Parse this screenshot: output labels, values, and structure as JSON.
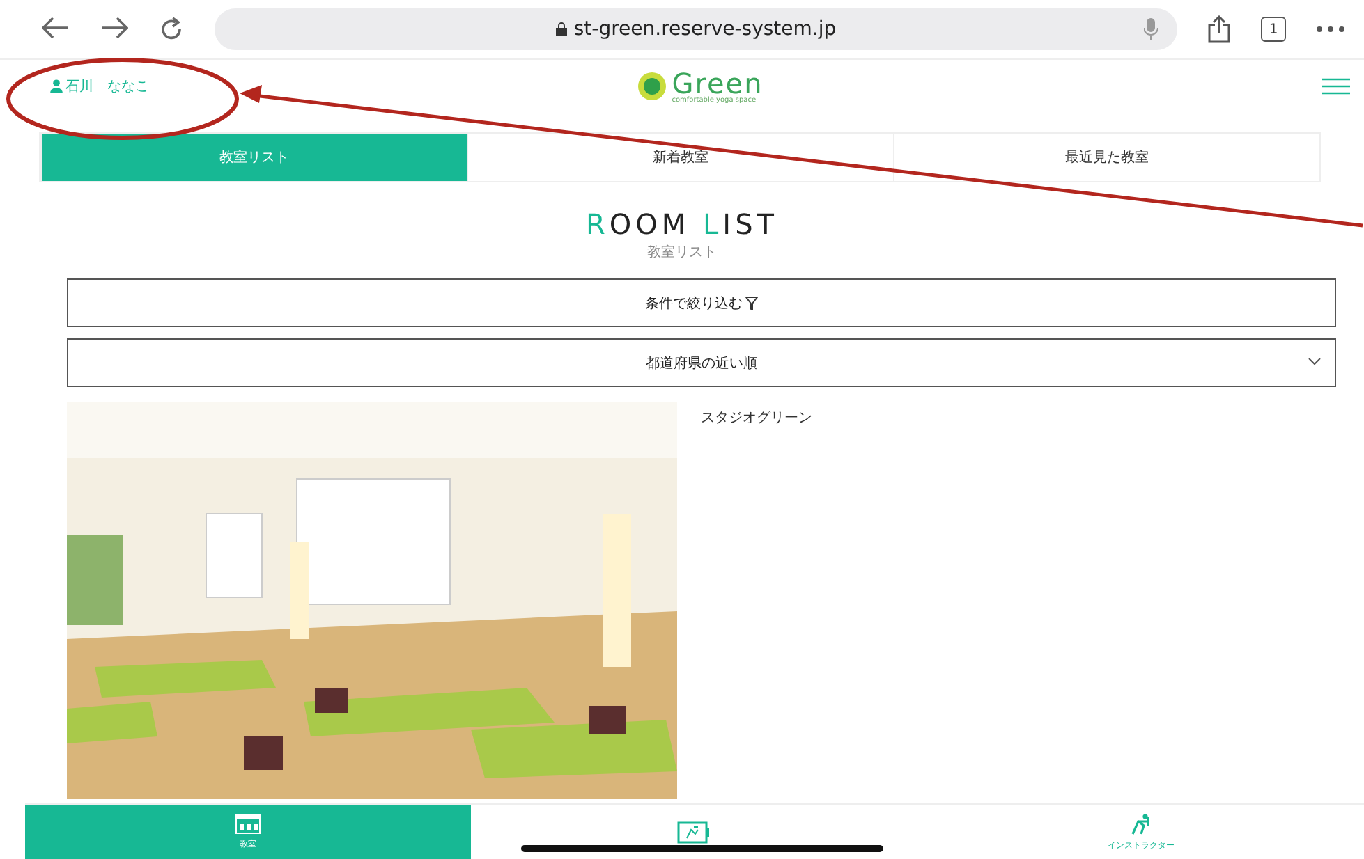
{
  "browser": {
    "url": "st-green.reserve-system.jp",
    "tab_count": "1"
  },
  "header": {
    "user_name": "石川　ななこ",
    "logo_name": "Green",
    "logo_tagline": "comfortable yoga space"
  },
  "tabs": [
    {
      "label": "教室リスト",
      "selected": true
    },
    {
      "label": "新着教室",
      "selected": false
    },
    {
      "label": "最近見た教室",
      "selected": false
    }
  ],
  "heading": {
    "title_parts": [
      {
        "text": "R",
        "accent": true
      },
      {
        "text": "OOM ",
        "accent": false
      },
      {
        "text": "L",
        "accent": true
      },
      {
        "text": "IST",
        "accent": false
      }
    ],
    "subtitle": "教室リスト"
  },
  "filter_button": {
    "label": "条件で絞り込む"
  },
  "sort_select": {
    "value": "都道府県の近い順"
  },
  "rooms": [
    {
      "name": "スタジオグリーン",
      "kind": "picture"
    }
  ],
  "bottom_nav": [
    {
      "label": "教室",
      "kind": "calendar",
      "selected": true
    },
    {
      "kind": "screen",
      "selected": false
    },
    {
      "label": "インストラクター",
      "kind": "figure",
      "selected": false
    }
  ]
}
